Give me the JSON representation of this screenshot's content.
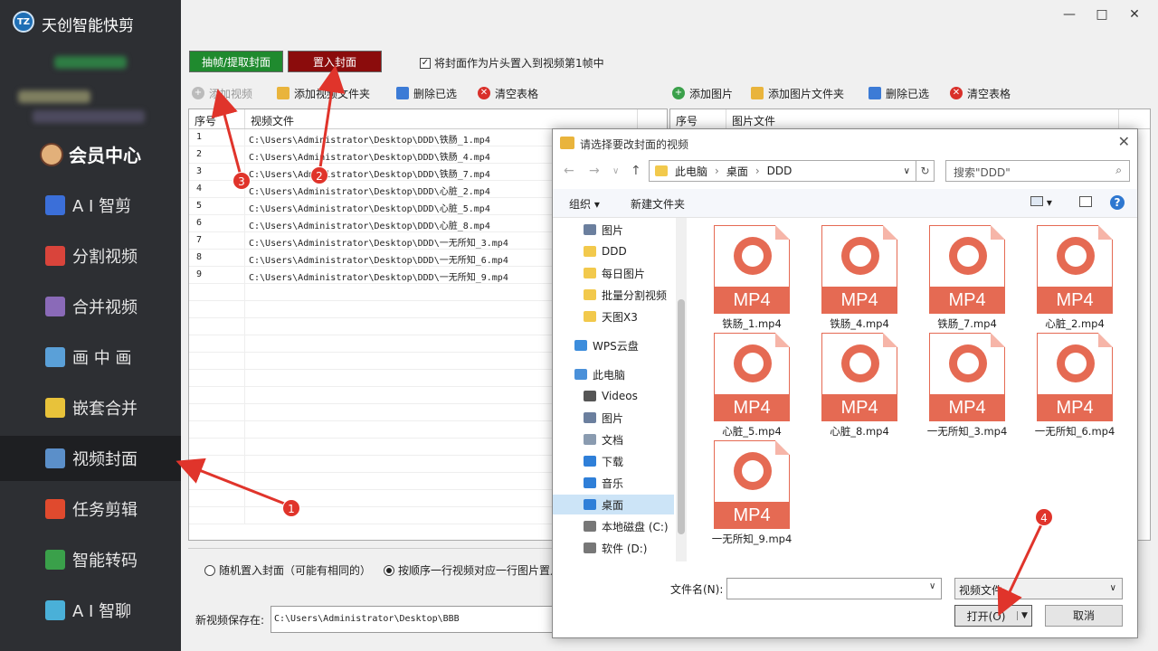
{
  "app": {
    "title": "天创智能快剪",
    "logo_text": "TZ"
  },
  "window_controls": {
    "minimize": "—",
    "maximize": "□",
    "close": "✕"
  },
  "sidebar": {
    "member": "会员中心",
    "items": [
      {
        "label": "A I 智剪",
        "icon": "ai-cut-icon",
        "color": "#3b6fd9"
      },
      {
        "label": "分割视频",
        "icon": "split-icon",
        "color": "#d9443b"
      },
      {
        "label": "合并视频",
        "icon": "merge-icon",
        "color": "#8a6ab8"
      },
      {
        "label": "画 中 画",
        "icon": "pip-icon",
        "color": "#5aa0d8"
      },
      {
        "label": "嵌套合并",
        "icon": "nest-icon",
        "color": "#e8c23a"
      },
      {
        "label": "视频封面",
        "icon": "cover-icon",
        "color": "#5b8fc9"
      },
      {
        "label": "任务剪辑",
        "icon": "task-icon",
        "color": "#e04a2e"
      },
      {
        "label": "智能转码",
        "icon": "transcode-icon",
        "color": "#3aa04a"
      },
      {
        "label": "A I 智聊",
        "icon": "chat-icon",
        "color": "#4ab0d8"
      }
    ],
    "active_index": 5
  },
  "top_buttons": {
    "extract": "抽帧/提取封面",
    "place": "置入封面",
    "checkbox_label": "将封面作为片头置入到视频第1帧中",
    "checkbox_checked": "✓"
  },
  "video_toolbar": {
    "add_video": "添加视频",
    "add_folder": "添加视频文件夹",
    "delete_selected": "删除已选",
    "clear_table": "清空表格"
  },
  "image_toolbar": {
    "add_image": "添加图片",
    "add_folder": "添加图片文件夹",
    "delete_selected": "删除已选",
    "clear_table": "清空表格"
  },
  "video_table": {
    "headers": [
      "序号",
      "视频文件"
    ],
    "rows": [
      [
        "1",
        "C:\\Users\\Administrator\\Desktop\\DDD\\铁肠_1.mp4"
      ],
      [
        "2",
        "C:\\Users\\Administrator\\Desktop\\DDD\\铁肠_4.mp4"
      ],
      [
        "3",
        "C:\\Users\\Administrator\\Desktop\\DDD\\铁肠_7.mp4"
      ],
      [
        "4",
        "C:\\Users\\Administrator\\Desktop\\DDD\\心脏_2.mp4"
      ],
      [
        "5",
        "C:\\Users\\Administrator\\Desktop\\DDD\\心脏_5.mp4"
      ],
      [
        "6",
        "C:\\Users\\Administrator\\Desktop\\DDD\\心脏_8.mp4"
      ],
      [
        "7",
        "C:\\Users\\Administrator\\Desktop\\DDD\\一无所知_3.mp4"
      ],
      [
        "8",
        "C:\\Users\\Administrator\\Desktop\\DDD\\一无所知_6.mp4"
      ],
      [
        "9",
        "C:\\Users\\Administrator\\Desktop\\DDD\\一无所知_9.mp4"
      ]
    ]
  },
  "image_table": {
    "headers": [
      "序号",
      "图片文件"
    ]
  },
  "options": {
    "random": "随机置入封面（可能有相同的）",
    "sequential": "按顺序一行视频对应一行图片置入"
  },
  "save": {
    "label": "新视频保存在:",
    "path": "C:\\Users\\Administrator\\Desktop\\BBB"
  },
  "dialog": {
    "title": "请选择要改封面的视频",
    "close": "✕",
    "back": "←",
    "forward": "→",
    "up": "↑",
    "dropdown": "∨",
    "breadcrumb": [
      "此电脑",
      "桌面",
      "DDD"
    ],
    "refresh": "↻",
    "search_placeholder": "搜索\"DDD\"",
    "organize": "组织 ▾",
    "new_folder": "新建文件夹",
    "help": "?",
    "tree": [
      {
        "label": "图片",
        "color": "#6b7f9e",
        "indent": 1
      },
      {
        "label": "DDD",
        "color": "#f2c94c",
        "indent": 1
      },
      {
        "label": "每日图片",
        "color": "#f2c94c",
        "indent": 1
      },
      {
        "label": "批量分割视频",
        "color": "#f2c94c",
        "indent": 1
      },
      {
        "label": "天图X3",
        "color": "#f2c94c",
        "indent": 1
      },
      {
        "label": "WPS云盘",
        "color": "#3c8ddc",
        "indent": 0
      },
      {
        "label": "此电脑",
        "color": "#4a90d9",
        "indent": 0
      },
      {
        "label": "Videos",
        "color": "#555555",
        "indent": 1
      },
      {
        "label": "图片",
        "color": "#6b7f9e",
        "indent": 1
      },
      {
        "label": "文档",
        "color": "#8a9bb0",
        "indent": 1
      },
      {
        "label": "下载",
        "color": "#2f7fd8",
        "indent": 1
      },
      {
        "label": "音乐",
        "color": "#2f7fd8",
        "indent": 1
      },
      {
        "label": "桌面",
        "color": "#2f7fd8",
        "indent": 1
      },
      {
        "label": "本地磁盘 (C:)",
        "color": "#777777",
        "indent": 1
      },
      {
        "label": "软件 (D:)",
        "color": "#777777",
        "indent": 1
      }
    ],
    "tree_selected_index": 12,
    "files": [
      "铁肠_1.mp4",
      "铁肠_4.mp4",
      "铁肠_7.mp4",
      "心脏_2.mp4",
      "心脏_5.mp4",
      "心脏_8.mp4",
      "一无所知_3.mp4",
      "一无所知_6.mp4",
      "一无所知_9.mp4"
    ],
    "file_badge": "MP4",
    "filename_label": "文件名(N):",
    "filetype": "视频文件",
    "open": "打开(O)",
    "cancel": "取消"
  },
  "annotations": [
    "1",
    "2",
    "3",
    "4"
  ]
}
